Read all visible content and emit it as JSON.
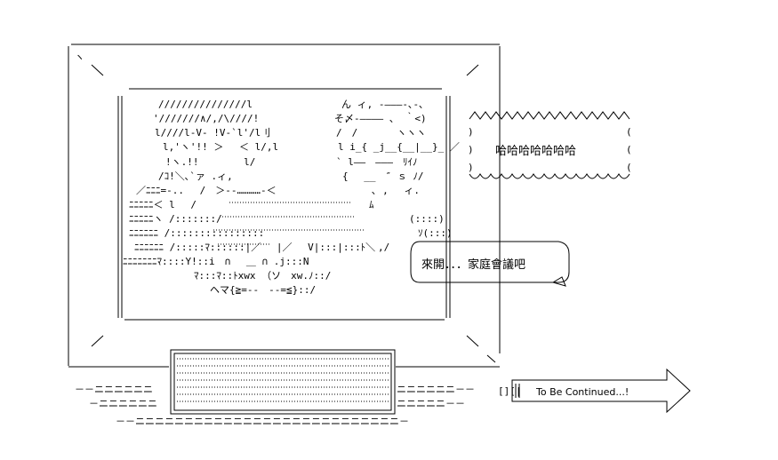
{
  "tv_caption": "To Be Continued...!",
  "laugh_bubble": "哈哈哈哈哈哈哈",
  "speech_bubble": "來開．．．家庭會議吧",
  "character_right_mouth": "ﾑ"
}
